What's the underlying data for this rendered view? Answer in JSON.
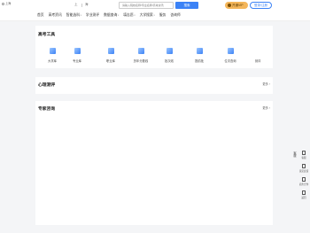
{
  "top": {
    "location_label": "上海"
  },
  "header": {
    "city_left": "上",
    "city_right": "海",
    "search_placeholder": "请输入院校名称/专业名称/高考资讯",
    "search_button": "搜索",
    "vip_button": "开通VIP",
    "login_button": "登录/注册"
  },
  "nav": [
    {
      "label": "首页",
      "has_caret": false
    },
    {
      "label": "高考资讯",
      "has_caret": false
    },
    {
      "label": "智能选科",
      "has_caret": true
    },
    {
      "label": "学业测评",
      "has_caret": false
    },
    {
      "label": "数据查询",
      "has_caret": true
    },
    {
      "label": "填志愿",
      "has_caret": true
    },
    {
      "label": "大学搜索",
      "has_caret": true
    },
    {
      "label": "服务",
      "has_caret": false
    },
    {
      "label": "咨询师",
      "has_caret": false
    }
  ],
  "tools": {
    "title": "高考工具",
    "items": [
      {
        "label": "大学库",
        "icon": "university-icon"
      },
      {
        "label": "专业库",
        "icon": "book-icon"
      },
      {
        "label": "职业库",
        "icon": "briefcase-icon"
      },
      {
        "label": "历年分数线",
        "icon": "document-icon"
      },
      {
        "label": "批次线",
        "icon": "layers-icon"
      },
      {
        "label": "提前批",
        "icon": "chart-icon"
      },
      {
        "label": "位次查询",
        "icon": "search-icon"
      },
      {
        "label": "测评",
        "icon": "test-icon"
      }
    ]
  },
  "psy": {
    "title": "心理测评",
    "more": "更多 ›"
  },
  "expert": {
    "title": "专家咨询",
    "more": "更多 ›"
  },
  "side": {
    "service_label": "客服",
    "items": [
      {
        "label": "客服",
        "icon": "phone-icon"
      },
      {
        "label": "意见反馈",
        "icon": "feedback-icon"
      },
      {
        "label": "商务合作",
        "icon": "handshake-icon"
      },
      {
        "label": "返回",
        "icon": "top-icon"
      }
    ]
  }
}
